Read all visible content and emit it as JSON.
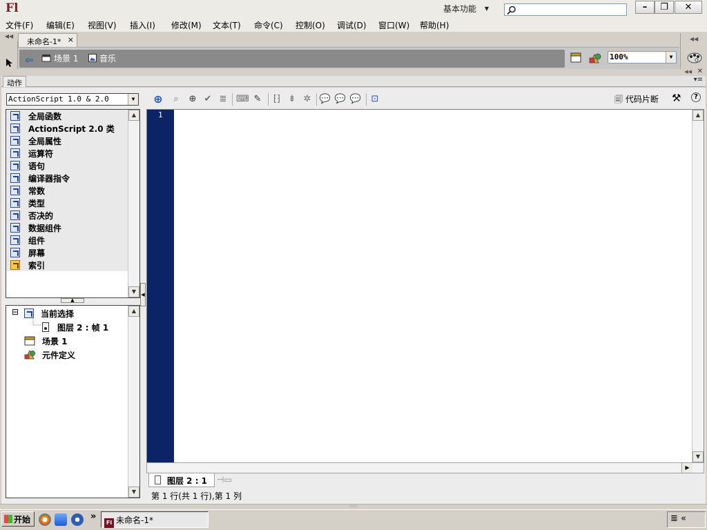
{
  "titlebar": {
    "app_logo": "Fl",
    "workspace_label": "基本功能",
    "search_placeholder": "",
    "min_glyph": "–",
    "max_glyph": "❐",
    "close_glyph": "✕"
  },
  "menu": {
    "items": [
      "文件(F)",
      "编辑(E)",
      "视图(V)",
      "插入(I)",
      "修改(M)",
      "文本(T)",
      "命令(C)",
      "控制(O)",
      "调试(D)",
      "窗口(W)",
      "帮助(H)"
    ]
  },
  "document": {
    "tab_title": "未命名-1*",
    "tab_close": "×"
  },
  "editbar": {
    "scene_label": "场景 1",
    "symbol_label": "音乐",
    "zoom_value": "100%"
  },
  "actions_panel": {
    "tab_label": "动作",
    "language_select": "ActionScript 1.0 & 2.0",
    "toolbox_items": [
      {
        "label": "全局函数",
        "icon": "book-icon"
      },
      {
        "label": "ActionScript 2.0 类",
        "icon": "book-icon"
      },
      {
        "label": "全局属性",
        "icon": "book-icon"
      },
      {
        "label": "运算符",
        "icon": "book-icon"
      },
      {
        "label": "语句",
        "icon": "book-icon"
      },
      {
        "label": "编译器指令",
        "icon": "book-icon"
      },
      {
        "label": "常数",
        "icon": "book-icon"
      },
      {
        "label": "类型",
        "icon": "book-icon"
      },
      {
        "label": "否决的",
        "icon": "book-icon"
      },
      {
        "label": "数据组件",
        "icon": "book-icon"
      },
      {
        "label": "组件",
        "icon": "book-icon"
      },
      {
        "label": "屏幕",
        "icon": "book-icon"
      },
      {
        "label": "索引",
        "icon": "index-book-icon"
      }
    ],
    "tree": {
      "current_selection": "当前选择",
      "frame_label": "图层 2 : 帧 1",
      "scene_label": "场景 1",
      "symbol_definitions": "元件定义",
      "collapse_glyph": "⊟"
    },
    "snippets_label": "代码片断",
    "editor": {
      "line_number": "1",
      "code": ""
    },
    "frame_tab_label": "图层 2 : 1",
    "status_text": "第 1 行(共 1 行),第 1 列"
  },
  "taskbar": {
    "start_label": "开始",
    "task_label": "未命名-1*",
    "chevron": "»",
    "tray_glyph": "≣ «"
  }
}
